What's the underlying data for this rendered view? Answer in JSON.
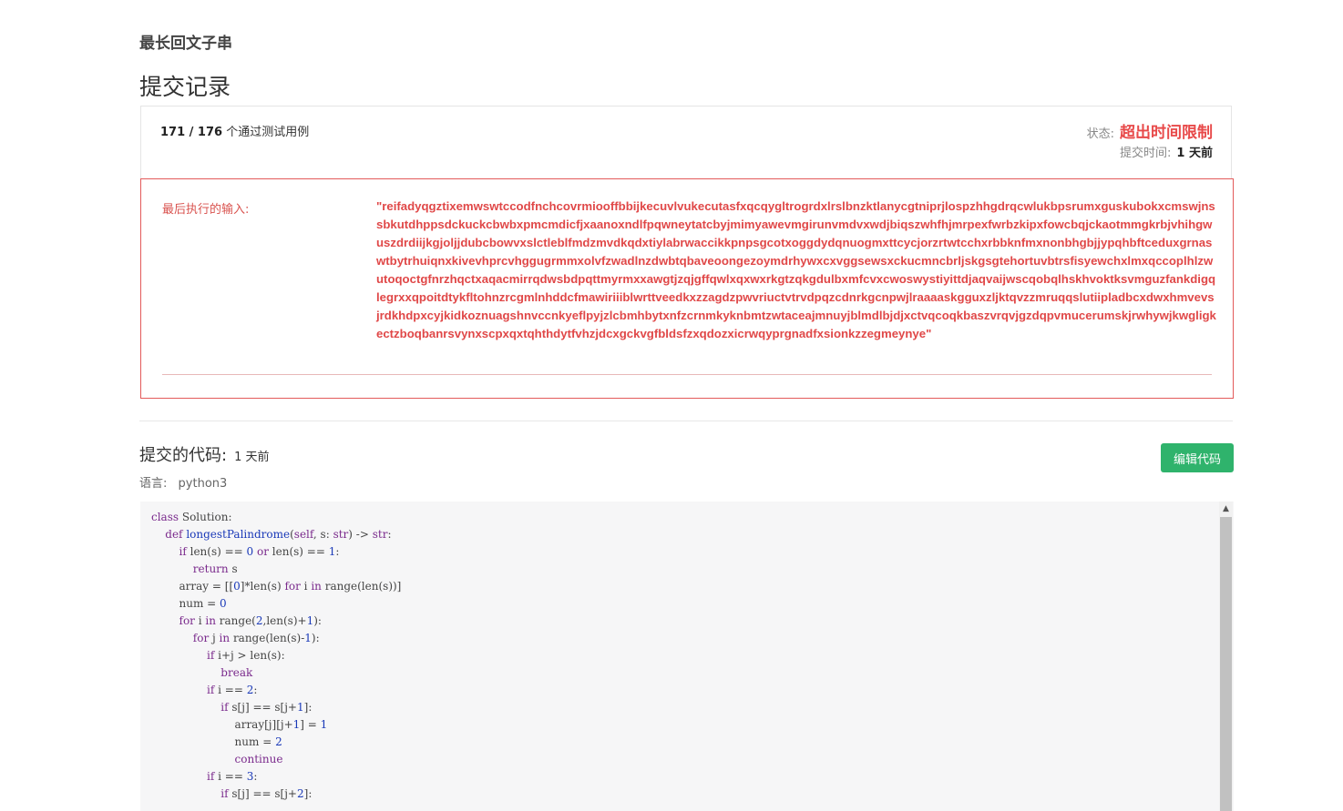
{
  "problem_title": "最长回文子串",
  "page_title": "提交记录",
  "summary": {
    "passed_count": "171 / 176",
    "passed_suffix": " 个通过测试用例",
    "status_label": "状态:",
    "status_value": "超出时间限制",
    "time_label": "提交时间:",
    "time_value": "1 天前"
  },
  "last_input": {
    "label": "最后执行的输入:",
    "value": "\"reifadyqgztixemwswtccodfnchcovrmiooffbbijkecuvlvukecutasfxqcqygltrogrdxlrslbnzktlanycgtniprjlospzhhgdrqcwlukbpsrumxguskubokxcmswjnssbkutdhppsdckuckcbwbxpmcmdicfjxaanoxndlfpqwneytatcbyjmimyawevmgirunvmdvxwdjbiqszwhfhjmrpexfwrbzkipxfowcbqjckaotmmgkrbjvhihgwuszdrdiijkgjoljjdubcbowvxslctleblfmdzmvdkqdxtiylabrwaccikkpnpsgcotxoggdydqnuogmxttcycjorzrtwtcchxrbbknfmxnonbhgbjjypqhbftceduxgrnaswtbytrhuiqnxkivevhprcvhggugrmmxolvfzwadlnzdwbtqbaveoongezoymdrhywxcxvggsewsxckucmncbrljskgsgtehortuvbtrsfisyewchxlmxqccoplhlzwutoqoctgfnrzhqctxaqacmirrqdwsbdpqttmyrmxxawgtjzqjgffqwlxqxwxrkgtzqkgdulbxmfcvxcwoswystiyittdjaqvaijwscqobqlhskhvoktksvmguzfankdigqlegrxxqpoitdtykfltohnzrcgmlnhddcfmawiriiiblwrttveedkxzzagdzpwvriuctvtrvdpqzcdnrkgcnpwjlraaaaskgguxzljktqvzzmruqqslutiipladbcxdwxhmvevsjrdkhdpxcyjkidkoznuagshnvccnkyeflpyjzlcbmhbytxnfzcrnmkyknbmtzwtaceajmnuyjblmdlbjdjxctvqcoqkbaszvrqvjgzdqpvmucerumskjrwhywjkwgligkectzboqbanrsvynxscpxqxtqhthdytfvhzjdcxgckvgfbldsfzxqdozxicrwqyprgnadfxsionkzzegmeynye\""
  },
  "code_section": {
    "heading": "提交的代码:",
    "time": "1 天前",
    "edit_button": "编辑代码",
    "language_label": "语言:",
    "language_value": "python3"
  },
  "code_lines": [
    "class Solution:",
    "    def longestPalindrome(self, s: str) -> str:",
    "        if len(s) == 0 or len(s) == 1:",
    "            return s",
    "        array = [[0]*len(s) for i in range(len(s))]",
    "        num = 0",
    "        for i in range(2,len(s)+1):",
    "            for j in range(len(s)-1):",
    "                if i+j > len(s):",
    "                    break",
    "                if i == 2:",
    "                    if s[j] == s[j+1]:",
    "                        array[j][j+1] = 1",
    "                        num = 2",
    "                        continue",
    "                if i == 3:",
    "                    if s[j] == s[j+2]:"
  ],
  "icons": {
    "scroll_up": "chevron-up-icon"
  },
  "colors": {
    "status_red": "#e84a4a",
    "button_green": "#2fb36c",
    "keyword_purple": "#7a2a8c",
    "number_blue": "#1a39b8"
  }
}
